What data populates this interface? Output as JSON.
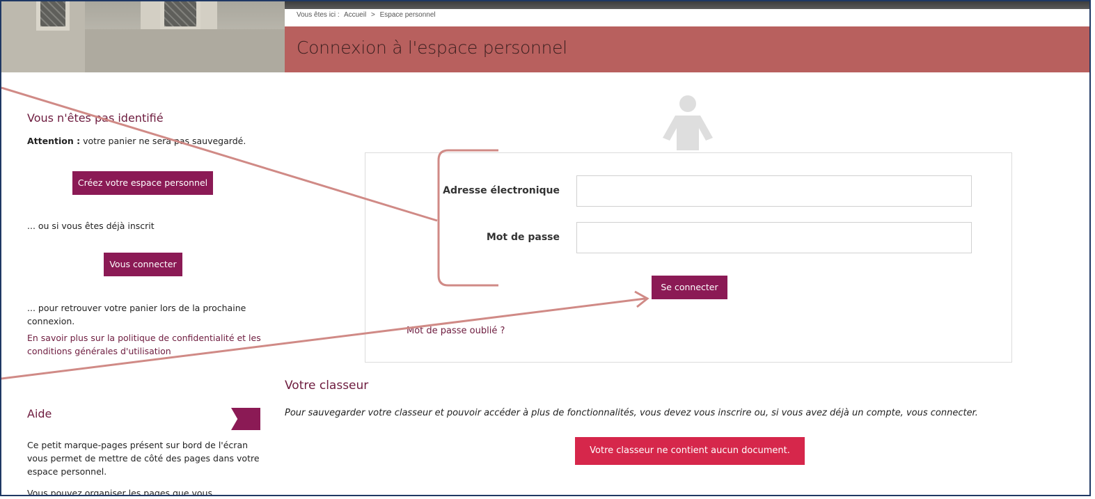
{
  "breadcrumb": {
    "prefix": "Vous êtes ici :",
    "items": [
      "Accueil",
      ">",
      "Espace personnel"
    ]
  },
  "page_title": "Connexion à l'espace personnel",
  "sidebar": {
    "heading": "Vous n'êtes pas identifié",
    "attention_label": "Attention :",
    "attention_text": " votre panier ne sera pas sauvegardé.",
    "create_button": "Créez votre espace personnel",
    "already_text": "... ou si vous êtes déjà inscrit",
    "connect_button": "Vous connecter",
    "retrieve_text_1": "... pour retrouver votre panier lors de la prochaine",
    "retrieve_text_2": "connexion.",
    "privacy_link_1": "En savoir plus sur la politique de confidentialité et les",
    "privacy_link_2": "conditions générales d'utilisation",
    "help_heading": "Aide",
    "help_text_1": "Ce petit marque-pages présent sur bord de l'écran",
    "help_text_2": "vous permet de mettre de côté des pages dans votre",
    "help_text_3": "espace personnel.",
    "help_text_4": "Vous pouvez organiser les pages que vous"
  },
  "login": {
    "email_label": "Adresse électronique",
    "email_value": "",
    "password_label": "Mot de passe",
    "password_value": "",
    "submit_button": "Se connecter",
    "forgot_link": "Mot de passe oublié ?"
  },
  "classeur": {
    "heading": "Votre classeur",
    "intro": "Pour sauvegarder votre classeur et pouvoir accéder à plus de fonctionnalités, vous devez vous inscrire ou, si vous avez déjà un compte, vous connecter.",
    "empty_message": "Votre classeur ne contient aucun document."
  },
  "colors": {
    "brand": "#8b1a55",
    "title_bar": "#b8605e",
    "alert": "#d6274b",
    "annotation": "#d08a86"
  }
}
